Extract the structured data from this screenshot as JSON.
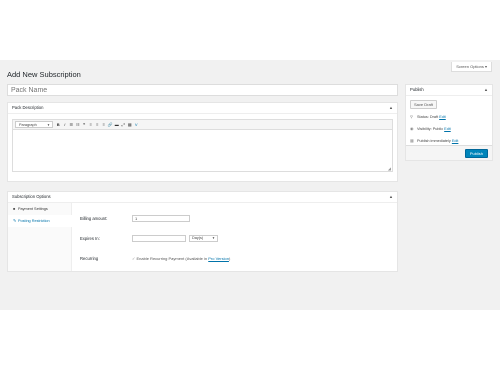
{
  "header": {
    "screen_options": "Screen Options ▾",
    "page_title": "Add New Subscription",
    "title_placeholder": "Pack Name"
  },
  "description_box": {
    "title": "Pack Description",
    "format_select": "Paragraph",
    "toolbar_glyphs": [
      "B",
      "I",
      "☰",
      "☷",
      "❝",
      "≡",
      "≡",
      "≡",
      "🔗",
      "▬",
      "⤢",
      "▦",
      "V"
    ]
  },
  "subscription_options": {
    "title": "Subscription Options",
    "tabs": [
      {
        "label": "Payment Settings",
        "icon": "🛒"
      },
      {
        "label": "Posting Restriction",
        "icon": "📌"
      }
    ],
    "billing_label": "Billing amount:",
    "billing_value": "1",
    "expires_label": "Expires In:",
    "expires_value": "",
    "expires_unit": "Day(s)",
    "recurring_label": "Recurring",
    "recurring_text": "Enable Recurring Payment (Available in",
    "recurring_link": "Pro Version",
    "recurring_close": ")"
  },
  "publish": {
    "title": "Publish",
    "save_draft": "Save Draft",
    "status_label": "Status:",
    "status_value": "Draft",
    "visibility_label": "Visibility:",
    "visibility_value": "Public",
    "publish_label": "Publish",
    "publish_value": "immediately",
    "edit": "Edit",
    "publish_button": "Publish"
  }
}
